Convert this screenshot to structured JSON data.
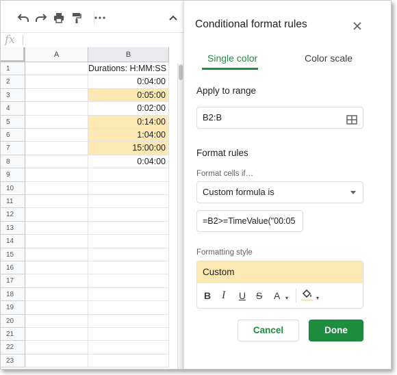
{
  "spreadsheet": {
    "formula_bar_label": "fx",
    "columns": [
      "A",
      "B"
    ],
    "rows": [
      {
        "num": "1",
        "b": "Durations: H:MM:SS",
        "highlight": false
      },
      {
        "num": "2",
        "b": "0:04:00",
        "highlight": false
      },
      {
        "num": "3",
        "b": "0:05:00",
        "highlight": true
      },
      {
        "num": "4",
        "b": "0:02:00",
        "highlight": false
      },
      {
        "num": "5",
        "b": "0:14:00",
        "highlight": true
      },
      {
        "num": "6",
        "b": "1:04:00",
        "highlight": true
      },
      {
        "num": "7",
        "b": "15:00:00",
        "highlight": true
      },
      {
        "num": "8",
        "b": "0:04:00",
        "highlight": false
      },
      {
        "num": "9",
        "b": "",
        "highlight": false
      },
      {
        "num": "10",
        "b": "",
        "highlight": false
      },
      {
        "num": "11",
        "b": "",
        "highlight": false
      },
      {
        "num": "12",
        "b": "",
        "highlight": false
      },
      {
        "num": "13",
        "b": "",
        "highlight": false
      },
      {
        "num": "14",
        "b": "",
        "highlight": false
      },
      {
        "num": "15",
        "b": "",
        "highlight": false
      },
      {
        "num": "16",
        "b": "",
        "highlight": false
      },
      {
        "num": "17",
        "b": "",
        "highlight": false
      },
      {
        "num": "18",
        "b": "",
        "highlight": false
      },
      {
        "num": "19",
        "b": "",
        "highlight": false
      },
      {
        "num": "20",
        "b": "",
        "highlight": false
      },
      {
        "num": "21",
        "b": "",
        "highlight": false
      },
      {
        "num": "22",
        "b": "",
        "highlight": false
      },
      {
        "num": "23",
        "b": "",
        "highlight": false
      }
    ],
    "highlight_color": "#fce8b2"
  },
  "panel": {
    "title": "Conditional format rules",
    "tabs": {
      "single": "Single color",
      "scale": "Color scale"
    },
    "apply_to_range_label": "Apply to range",
    "range_value": "B2:B",
    "format_rules_label": "Format rules",
    "format_cells_if_label": "Format cells if…",
    "condition_value": "Custom formula is",
    "formula_value": "=B2>=TimeValue(\"00:05",
    "formatting_style_label": "Formatting style",
    "style_preview": "Custom",
    "style_tools": {
      "bold": "B",
      "italic": "I",
      "underline": "U",
      "strike": "S",
      "text_color": "A"
    },
    "cancel_label": "Cancel",
    "done_label": "Done",
    "accent_color": "#1e8e3e"
  }
}
